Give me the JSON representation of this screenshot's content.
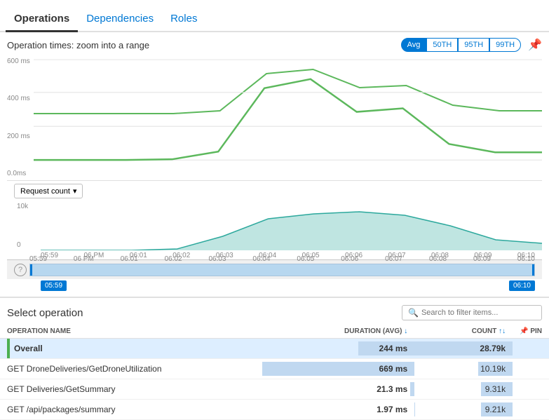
{
  "tabs": [
    {
      "label": "Operations",
      "active": true
    },
    {
      "label": "Dependencies",
      "active": false
    },
    {
      "label": "Roles",
      "active": false
    }
  ],
  "section": {
    "title": "Operation times: zoom into a range",
    "percentiles": [
      {
        "label": "Avg",
        "active": true
      },
      {
        "label": "50TH",
        "active": false
      },
      {
        "label": "95TH",
        "active": false
      },
      {
        "label": "99TH",
        "active": false
      }
    ]
  },
  "yAxis": {
    "labels": [
      "600 ms",
      "400 ms",
      "200 ms",
      "0.0ms"
    ]
  },
  "miniYAxis": {
    "labels": [
      "10k",
      "0"
    ]
  },
  "timeLabels": [
    "05:59",
    "06 PM",
    "06:01",
    "06:02",
    "06:03",
    "06:04",
    "06:05",
    "06:06",
    "06:07",
    "06:08",
    "06:09",
    "06:10"
  ],
  "rangeTimeLabels": [
    "05:59",
    "06 PM",
    "06:01",
    "06:02",
    "06:03",
    "06:04",
    "06:05",
    "06:06",
    "06:07",
    "06:08",
    "06:09",
    "06:10"
  ],
  "rangeStart": "05:59",
  "rangeEnd": "06:10",
  "requestCount": {
    "label": "Request count",
    "dropdownArrow": "▾"
  },
  "selectOperation": {
    "title": "Select operation",
    "searchPlaceholder": "Search to filter items..."
  },
  "table": {
    "headers": [
      {
        "label": "OPERATION NAME",
        "sortable": false
      },
      {
        "label": "DURATION (AVG)",
        "sortable": true,
        "sortIcon": "↓"
      },
      {
        "label": "COUNT",
        "sortable": true,
        "sortIcon": "↑↓"
      },
      {
        "label": "PIN",
        "sortable": false
      }
    ],
    "rows": [
      {
        "name": "Overall",
        "duration": "244 ms",
        "durationPct": 37,
        "count": "28.79k",
        "countPct": 100,
        "highlighted": true,
        "greenBar": true
      },
      {
        "name": "GET DroneDeliveries/GetDroneUtilization",
        "duration": "669 ms",
        "durationPct": 100,
        "count": "10.19k",
        "countPct": 35,
        "highlighted": false,
        "greenBar": false
      },
      {
        "name": "GET Deliveries/GetSummary",
        "duration": "21.3 ms",
        "durationPct": 3,
        "count": "9.31k",
        "countPct": 32,
        "highlighted": false,
        "greenBar": false
      },
      {
        "name": "GET /api/packages/summary",
        "duration": "1.97 ms",
        "durationPct": 0.3,
        "count": "9.21k",
        "countPct": 32,
        "highlighted": false,
        "greenBar": false
      }
    ]
  }
}
